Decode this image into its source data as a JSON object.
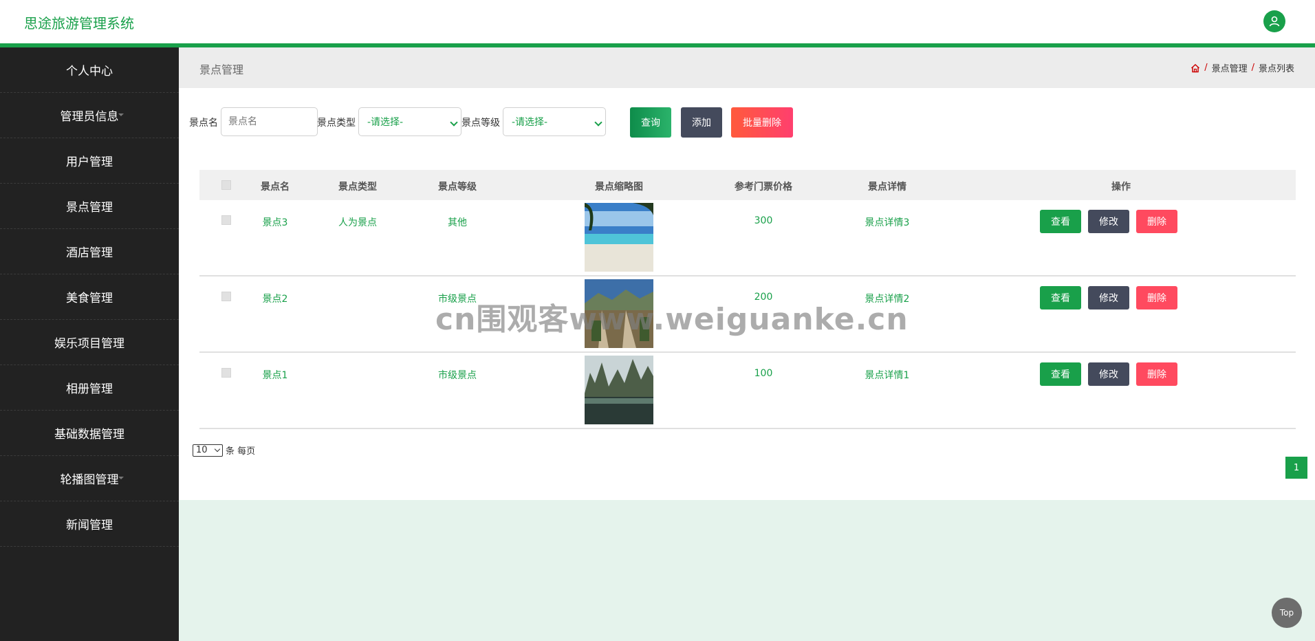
{
  "header": {
    "app_title": "思途旅游管理系统",
    "user_icon": "user-icon"
  },
  "sidebar": {
    "items": [
      {
        "label": "个人中心"
      },
      {
        "label": "管理员信息"
      },
      {
        "label": "用户管理"
      },
      {
        "label": "景点管理"
      },
      {
        "label": "酒店管理"
      },
      {
        "label": "美食管理"
      },
      {
        "label": "娱乐项目管理"
      },
      {
        "label": "相册管理"
      },
      {
        "label": "基础数据管理"
      },
      {
        "label": "轮播图管理"
      },
      {
        "label": "新闻管理"
      }
    ]
  },
  "page": {
    "title": "景点管理",
    "breadcrumb": {
      "home_icon": "home-icon",
      "sep": "/",
      "level1": "景点管理",
      "level2": "景点列表"
    }
  },
  "search": {
    "name_label": "景点名",
    "name_placeholder": "景点名",
    "type_label": "景点类型",
    "type_value": "-请选择-",
    "level_label": "景点等级",
    "level_value": "-请选择-",
    "query_button": "查询",
    "add_button": "添加",
    "batch_delete_button": "批量删除"
  },
  "table": {
    "headers": [
      "景点名",
      "景点类型",
      "景点等级",
      "景点缩略图",
      "参考门票价格",
      "景点详情",
      "操作"
    ],
    "rows": [
      {
        "name": "景点3",
        "type": "人为景点",
        "level": "其他",
        "price": "300",
        "detail": "景点详情3"
      },
      {
        "name": "景点2",
        "type": "",
        "level": "市级景点",
        "price": "200",
        "detail": "景点详情2"
      },
      {
        "name": "景点1",
        "type": "",
        "level": "市级景点",
        "price": "100",
        "detail": "景点详情1"
      }
    ],
    "actions": {
      "view": "查看",
      "edit": "修改",
      "delete": "删除"
    }
  },
  "pager": {
    "page_size": "10",
    "suffix": "条 每页",
    "current_page": "1"
  },
  "watermark": "cn围观客www.weiguanke.cn",
  "back_to_top": "Top",
  "colors": {
    "accent": "#19a04a",
    "sidebar_bg": "#222222",
    "delete": "#ff4a5f",
    "edit": "#444a5c"
  }
}
